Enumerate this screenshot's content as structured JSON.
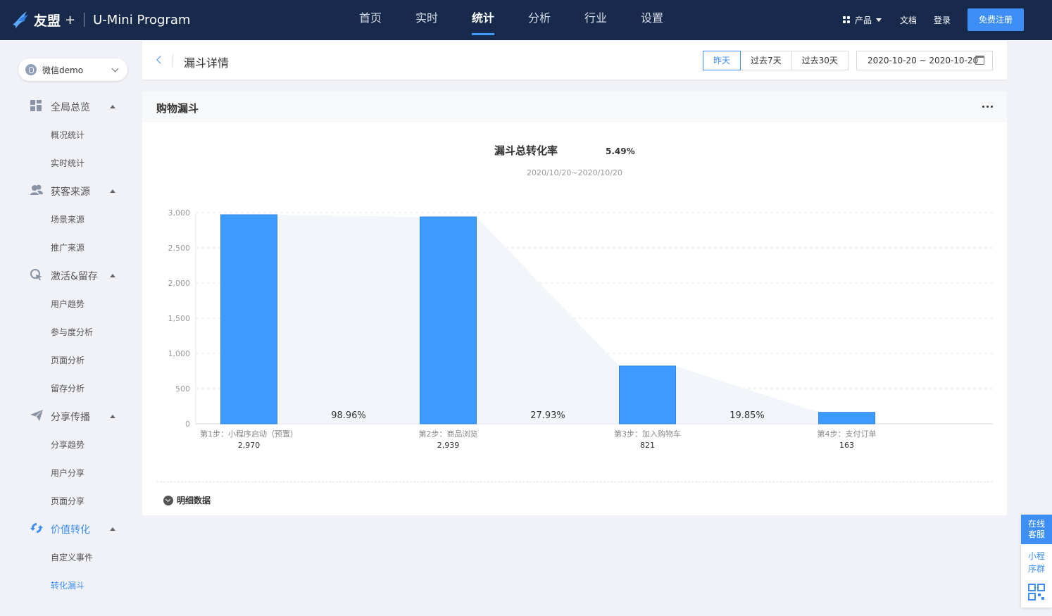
{
  "brand": {
    "name": "友盟",
    "plus": "+",
    "product": "U-Mini Program"
  },
  "nav": {
    "items": [
      "首页",
      "实时",
      "统计",
      "分析",
      "行业",
      "设置"
    ],
    "active_index": 2
  },
  "topright": {
    "product_label": "产品",
    "docs": "文档",
    "login": "登录",
    "register": "免费注册"
  },
  "app_select": {
    "value": "微信demo"
  },
  "sidebar": {
    "groups": [
      {
        "label": "全局总览",
        "icon": "dashboard-icon",
        "items": [
          "概况统计",
          "实时统计"
        ]
      },
      {
        "label": "获客来源",
        "icon": "users-icon",
        "items": [
          "场景来源",
          "推广来源"
        ]
      },
      {
        "label": "激活&留存",
        "icon": "cursor-icon",
        "items": [
          "用户趋势",
          "参与度分析",
          "页面分析",
          "留存分析"
        ]
      },
      {
        "label": "分享传播",
        "icon": "paper-plane-icon",
        "items": [
          "分享趋势",
          "用户分享",
          "页面分享"
        ]
      },
      {
        "label": "价值转化",
        "icon": "convert-icon",
        "items": [
          "自定义事件",
          "转化漏斗"
        ]
      }
    ],
    "active_group": "价值转化",
    "active_item": "转化漏斗"
  },
  "header": {
    "back": "<",
    "title": "漏斗详情",
    "ranges": [
      "昨天",
      "过去7天",
      "过去30天"
    ],
    "active_range": "昨天",
    "date_range": "2020-10-20 ~ 2020-10-20"
  },
  "card": {
    "title": "购物漏斗",
    "detail_label": "明细数据"
  },
  "chart_data": {
    "type": "bar",
    "title": "漏斗总转化率",
    "total_rate": "5.49%",
    "subtitle": "2020/10/20~2020/10/20",
    "categories": [
      "第1步：小程序启动（预置）",
      "第2步：商品浏览",
      "第3步：加入购物车",
      "第4步：支付订单"
    ],
    "values": [
      2970,
      2939,
      821,
      163
    ],
    "value_labels": [
      "2,970",
      "2,939",
      "821",
      "163"
    ],
    "conversion_rates": [
      "98.96%",
      "27.93%",
      "19.85%"
    ],
    "y_ticks": [
      "0",
      "500",
      "1,000",
      "1,500",
      "2,000",
      "2,500",
      "3,000"
    ],
    "ylim": [
      0,
      3000
    ],
    "grid": true,
    "bar_color": "#3d9bff"
  },
  "float_panel": {
    "service": [
      "在线",
      "客服"
    ],
    "group": [
      "小程",
      "序群"
    ],
    "qr_icon": "qr-code-icon"
  },
  "colors": {
    "topbar": "#172a4b",
    "accent": "#3d8ff5",
    "background": "#f0f2f7"
  }
}
